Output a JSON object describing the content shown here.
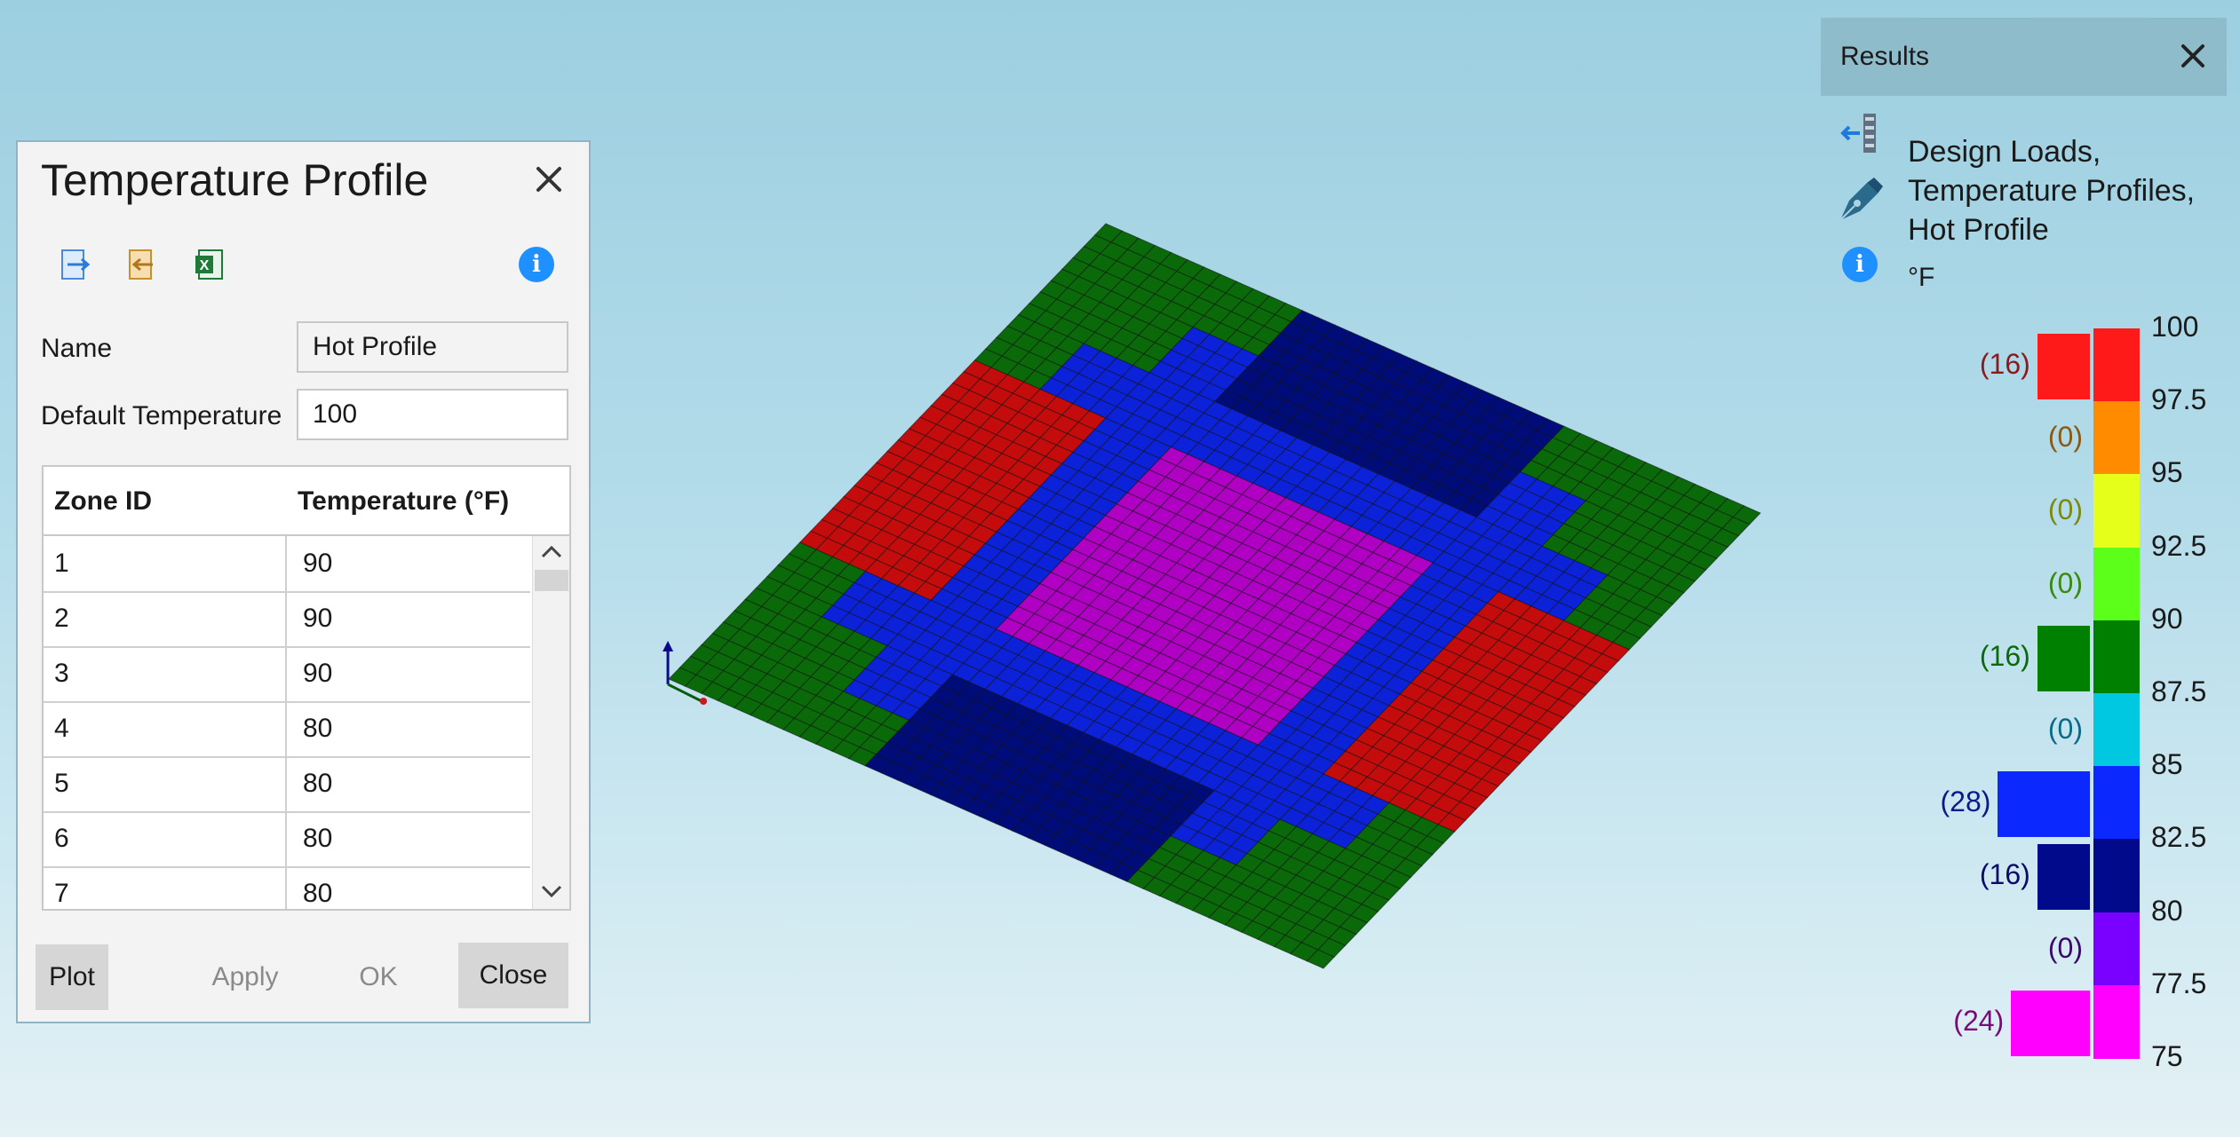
{
  "dialog": {
    "title": "Temperature Profile",
    "name_label": "Name",
    "name_value": "Hot Profile",
    "default_temp_label": "Default Temperature",
    "default_temp_value": "100",
    "columns": [
      "Zone ID",
      "Temperature (°F)"
    ],
    "rows": [
      {
        "zone": "1",
        "temp": "90"
      },
      {
        "zone": "2",
        "temp": "90"
      },
      {
        "zone": "3",
        "temp": "90"
      },
      {
        "zone": "4",
        "temp": "80"
      },
      {
        "zone": "5",
        "temp": "80"
      },
      {
        "zone": "6",
        "temp": "80"
      },
      {
        "zone": "7",
        "temp": "80"
      }
    ],
    "buttons": {
      "plot": "Plot",
      "apply": "Apply",
      "ok": "OK",
      "close": "Close"
    },
    "icons": [
      "import-icon",
      "export-icon",
      "excel-icon",
      "info-icon"
    ]
  },
  "results": {
    "header": "Results",
    "lines": [
      "Design Loads,",
      "Temperature Profiles,",
      "Hot Profile"
    ],
    "unit": "°F",
    "legend": [
      {
        "tick": "100",
        "count": "(16)",
        "color": "#ff1a1a",
        "count_color": "#8b1a1a",
        "n": 16
      },
      {
        "tick": "97.5",
        "count": "(0)",
        "color": "#ff8c00",
        "count_color": "#8b5a10",
        "n": 0
      },
      {
        "tick": "95",
        "count": "(0)",
        "color": "#e6ff1a",
        "count_color": "#7a8a10",
        "n": 0
      },
      {
        "tick": "92.5",
        "count": "(0)",
        "color": "#5cff1a",
        "count_color": "#3a8a10",
        "n": 0
      },
      {
        "tick": "90",
        "count": "(16)",
        "color": "#008000",
        "count_color": "#0a6a0a",
        "n": 16
      },
      {
        "tick": "87.5",
        "count": "(0)",
        "color": "#00c8e0",
        "count_color": "#0a6a8a",
        "n": 0
      },
      {
        "tick": "85",
        "count": "(28)",
        "color": "#0a28ff",
        "count_color": "#0a1a8a",
        "n": 28
      },
      {
        "tick": "82.5",
        "count": "(16)",
        "color": "#000a8a",
        "count_color": "#0a0a6a",
        "n": 16
      },
      {
        "tick": "80",
        "count": "(0)",
        "color": "#7a00ff",
        "count_color": "#3a0a6a",
        "n": 0
      },
      {
        "tick": "77.5",
        "count": "(24)",
        "color": "#ff00ff",
        "count_color": "#7a0a7a",
        "n": 24
      },
      {
        "tick": "75"
      }
    ]
  },
  "model": {
    "zone_colors": {
      "hot_100": "#c40c0c",
      "zone_90": "#0a6a0a",
      "zone_85": "#0c22d8",
      "zone_82_5": "#000c78",
      "zone_77_5": "#b000c4"
    }
  }
}
